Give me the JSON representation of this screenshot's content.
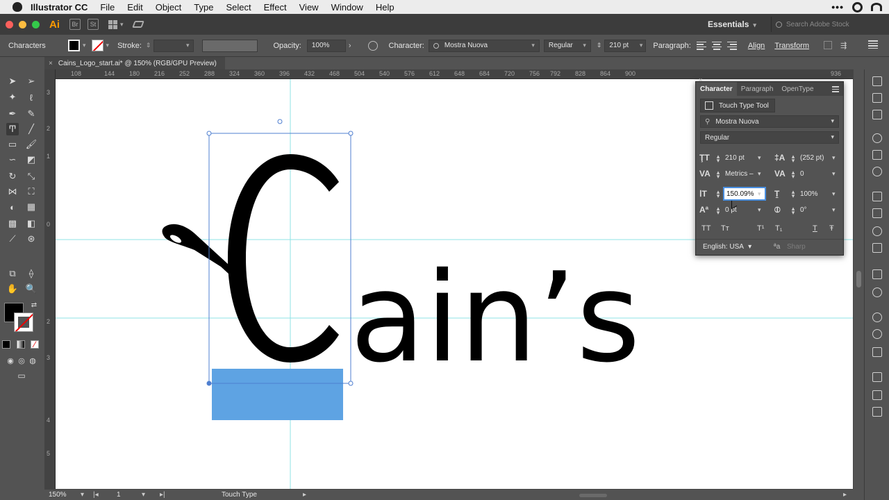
{
  "menubar": {
    "app_name": "Illustrator CC",
    "items": [
      "File",
      "Edit",
      "Object",
      "Type",
      "Select",
      "Effect",
      "View",
      "Window",
      "Help"
    ]
  },
  "appbar": {
    "logo": "Ai",
    "bridge": "Br",
    "stock": "St",
    "workspace": "Essentials",
    "search_placeholder": "Search Adobe Stock"
  },
  "controlbar": {
    "selection_label": "Characters",
    "stroke_label": "Stroke:",
    "opacity_label": "Opacity:",
    "opacity_value": "100%",
    "character_label": "Character:",
    "font_family": "Mostra Nuova",
    "font_style": "Regular",
    "font_size": "210 pt",
    "paragraph_label": "Paragraph:",
    "align_label": "Align",
    "transform_label": "Transform"
  },
  "document": {
    "tab_title": "Cains_Logo_start.ai* @ 150% (RGB/GPU Preview)",
    "close": "×",
    "ruler_h": [
      "108",
      "144",
      "180",
      "216",
      "252",
      "288",
      "324",
      "360",
      "396",
      "432",
      "468",
      "504",
      "540",
      "576",
      "612",
      "648",
      "684",
      "720",
      "756",
      "792",
      "828",
      "864",
      "900",
      "936"
    ],
    "ruler_v": [
      "3",
      "2",
      "1",
      "0",
      "2",
      "3",
      "4",
      "5"
    ],
    "artwork_text": "Cain’s"
  },
  "character_panel": {
    "tabs": [
      "Character",
      "Paragraph",
      "OpenType"
    ],
    "touch_type_label": "Touch Type Tool",
    "font_family": "Mostra Nuova",
    "font_style": "Regular",
    "font_size": "210 pt",
    "leading": "(252 pt)",
    "kerning": "Metrics –",
    "tracking": "0",
    "vertical_scale": "150.09%",
    "horizontal_scale": "100%",
    "baseline_shift": "0 pt",
    "rotation": "0°",
    "caps": [
      "TT",
      "Tт",
      "T¹",
      "T₁",
      "T",
      "Ŧ"
    ],
    "language": "English: USA",
    "aa_symbol": "ªa",
    "antialias": "Sharp"
  },
  "statusbar": {
    "zoom": "150%",
    "artboard": "1",
    "tool": "Touch Type"
  },
  "colors": {
    "guide": "#8fe3e6",
    "selection": "#4f7fd0",
    "blue_rect": "#5ea3e3",
    "logo_orange": "#ff9a00"
  }
}
